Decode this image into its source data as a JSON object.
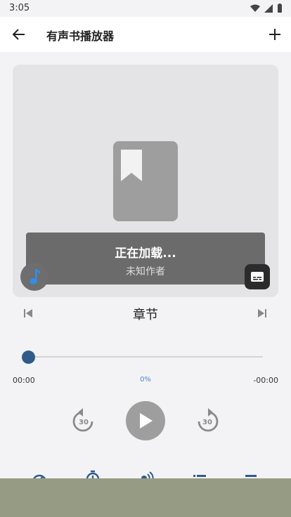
{
  "status_bar": {
    "time": "3:05"
  },
  "app_bar": {
    "title": "有声书播放器"
  },
  "cover": {
    "loading_title": "正在加载...",
    "author": "未知作者"
  },
  "chapter": {
    "label": "章节"
  },
  "progress": {
    "current_time": "00:00",
    "percent_label": "0%",
    "remaining_time": "-00:00",
    "value": 0
  },
  "controls": {
    "rewind_seconds": "30",
    "forward_seconds": "30"
  },
  "colors": {
    "accent": "#2f5b8a",
    "percent_text": "#4a86c5",
    "music_icon": "#2f8fe8",
    "bottom_overlay": "#969c84"
  },
  "icons": {
    "back": "arrow-left-icon",
    "add": "plus-icon",
    "cover": "bookmark-icon",
    "music": "music-note-icon",
    "subtitles": "subtitles-icon",
    "prev": "skip-previous-icon",
    "next": "skip-next-icon",
    "rewind": "replay-30-icon",
    "play": "play-icon",
    "forward": "forward-30-icon",
    "bottom": [
      "speed-icon",
      "sleep-timer-icon",
      "audio-icon",
      "list-icon",
      "queue-icon"
    ]
  }
}
